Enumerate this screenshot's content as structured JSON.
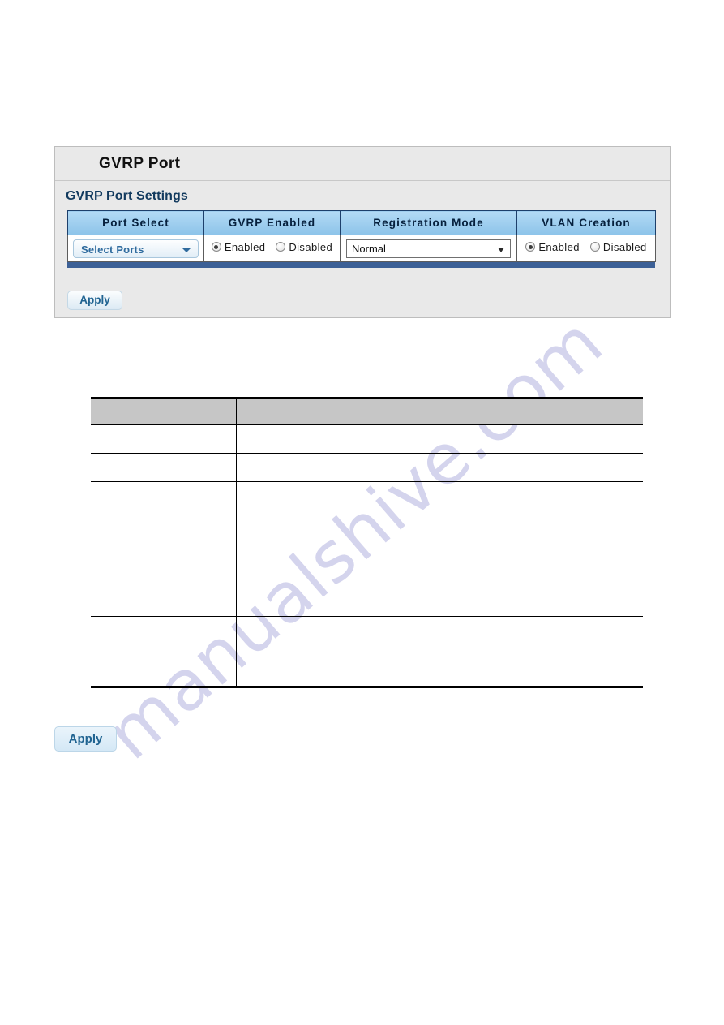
{
  "page": {
    "watermark_text": "manualshive.com",
    "watermark_color": "#c9c9e8",
    "background": "#ffffff"
  },
  "panel": {
    "title": "GVRP Port",
    "subtitle": "GVRP Port Settings",
    "background": "#e9e9e9",
    "header_accent": "#8cc3e9",
    "footer_strip_color": "#3c6096",
    "columns": [
      {
        "label": "Port Select"
      },
      {
        "label": "GVRP Enabled"
      },
      {
        "label": "Registration Mode"
      },
      {
        "label": "VLAN Creation"
      }
    ],
    "port_select": {
      "value": "Select Ports",
      "arrow_icon": "chevron-down-icon"
    },
    "gvrp_enabled": {
      "enabled_label": "Enabled",
      "disabled_label": "Disabled",
      "selected": "Enabled"
    },
    "registration_mode": {
      "value": "Normal",
      "arrow_icon": "chevron-down-icon"
    },
    "vlan_creation": {
      "enabled_label": "Enabled",
      "disabled_label": "Disabled",
      "selected": "Enabled"
    },
    "apply_label": "Apply"
  },
  "description_table": {
    "header_background": "#c6c6c6",
    "rows": [
      {
        "cells": [
          "",
          ""
        ]
      },
      {
        "cells": [
          "",
          ""
        ]
      },
      {
        "cells": [
          "",
          ""
        ]
      },
      {
        "cells": [
          "",
          ""
        ]
      }
    ],
    "header_cells": [
      "",
      ""
    ]
  },
  "footer": {
    "apply_label": "Apply"
  }
}
